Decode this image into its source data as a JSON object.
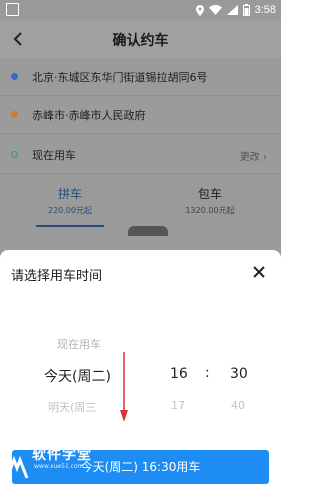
{
  "status_bar": {
    "time": "3:58"
  },
  "header": {
    "title": "确认约车"
  },
  "route": {
    "start": "北京·东城区东华门街道锡拉胡同6号",
    "end": "赤峰市·赤峰市人民政府",
    "time_label": "现在用车",
    "change_label": "更改"
  },
  "ride_tabs": [
    {
      "label": "拼车",
      "price": "220.00元起"
    },
    {
      "label": "包车",
      "price": "1320.00元起"
    }
  ],
  "sheet": {
    "title": "请选择用车时间",
    "picker": {
      "day_prev": "现在用车",
      "day": "今天(周二)",
      "day_next": "明天(周三",
      "hour": "16",
      "hour_next": "17",
      "separator": ":",
      "minute": "30",
      "minute_next": "40"
    },
    "confirm_label": "今天(周二) 16:30用车"
  },
  "watermark": {
    "text": "软件学堂",
    "url": "www.xue51.com"
  },
  "colors": {
    "accent": "#1e8df3",
    "dot_start": "#3a6ad0",
    "dot_end": "#d27a2a",
    "dot_time": "#2f9e54"
  }
}
